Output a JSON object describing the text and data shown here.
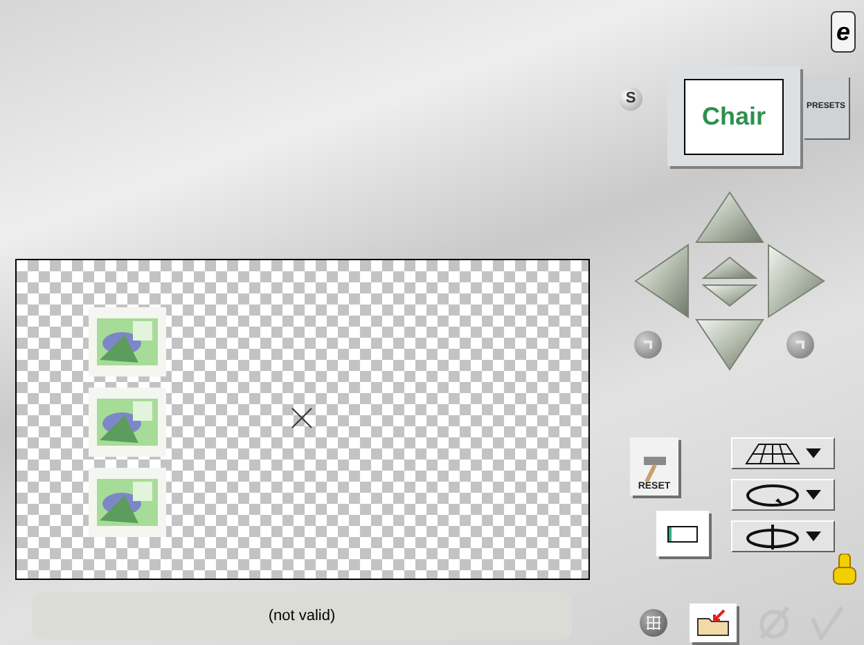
{
  "about_button": {
    "label": "e"
  },
  "shadow_button": {
    "label": "S"
  },
  "preset_preview": {
    "label": "Chair"
  },
  "presets_button": {
    "label": "PRESETS"
  },
  "reset_button": {
    "label": "RESET"
  },
  "status_bar": {
    "text": "(not valid)"
  }
}
